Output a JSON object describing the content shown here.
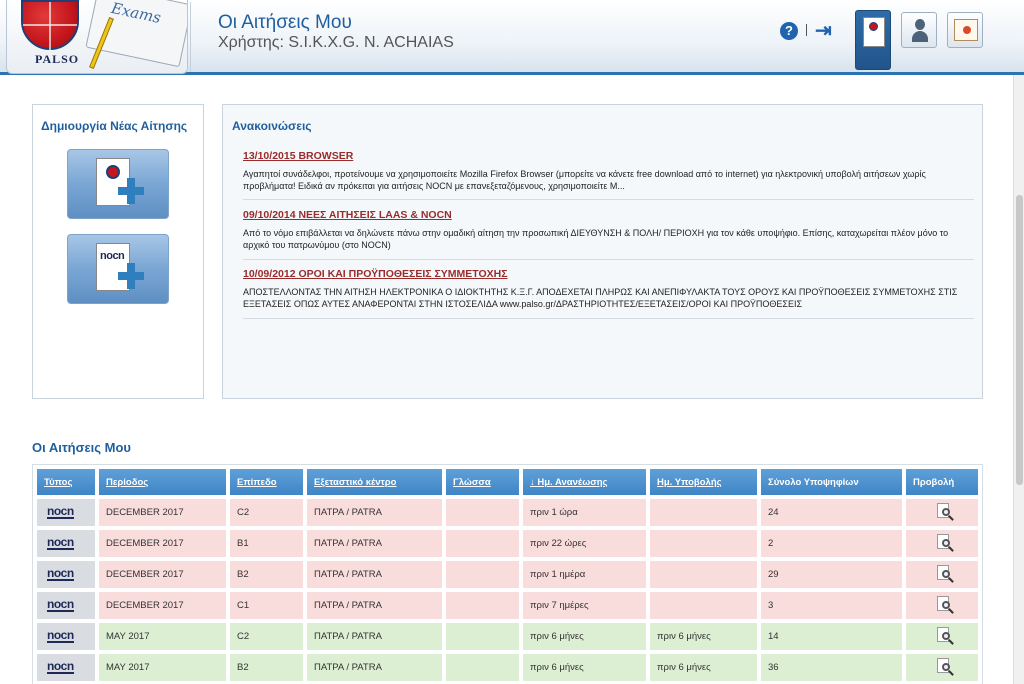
{
  "header": {
    "logo_text": "PALSO",
    "exams_text": "Exams",
    "page_title": "Οι Αιτήσεις Μου",
    "user_line": "Χρήστης: S.I.K.X.G. N. ACHAIAS",
    "help_symbol": "?",
    "logout_symbol": "⇥"
  },
  "create_panel": {
    "heading": "Δημιουργία Νέας Αίτησης",
    "nocn_label": "nocn"
  },
  "announcements": {
    "heading": "Ανακοινώσεις",
    "items": [
      {
        "title": "13/10/2015 BROWSER",
        "body": "Αγαπητοί συνάδελφοι, προτείνουμε να χρησιμοποιείτε Mozilla Firefox Browser (μπορείτε να κάνετε free download από το internet) για ηλεκτρονική υποβολή αιτήσεων χωρίς προβλήματα! Ειδικά αν πρόκειται για αιτήσεις NOCN με επανεξεταζόμενους, χρησιμοποιείτε M..."
      },
      {
        "title": "09/10/2014 ΝΕΕΣ ΑΙΤΗΣΕΙΣ LAAS & NOCN",
        "body": "Από το νόμο επιβάλλεται να δηλώνετε πάνω στην ομαδική αίτηση την προσωπική ΔΙΕΥΘΥΝΣΗ & ΠΟΛΗ/ ΠΕΡΙΟΧΗ για τον κάθε υποψήφιο. Επίσης, καταχωρείται πλέον μόνο το αρχικό του πατρωνύμου (στο NOCN)"
      },
      {
        "title": "10/09/2012 ΟΡΟΙ ΚΑΙ ΠΡΟΫΠΟΘΕΣΕΙΣ ΣΥΜΜΕΤΟΧΗΣ",
        "body": "ΑΠΟΣΤΕΛΛΟΝΤΑΣ ΤΗΝ ΑΙΤΗΣΗ ΗΛΕΚΤΡΟΝΙΚΑ Ο ΙΔΙΟΚΤΗΤΗΣ Κ.Ξ.Γ. ΑΠΟΔΕΧΕΤΑΙ ΠΛΗΡΩΣ ΚΑΙ ΑΝΕΠΙΦΥΛΑΚΤΑ ΤΟΥΣ ΟΡΟΥΣ ΚΑΙ ΠΡΟΫΠΟΘΕΣΕΙΣ ΣΥΜΜΕΤΟΧΗΣ ΣΤΙΣ ΕΞΕΤΑΣΕΙΣ ΟΠΩΣ ΑΥΤΕΣ ΑΝΑΦΕΡΟΝΤΑΙ ΣΤΗΝ ΙΣΤΟΣΕΛΙΔΑ www.palso.gr/ΔΡΑΣΤΗΡΙΟΤΗΤΕΣ/ΕΞΕΤΑΣΕΙΣ/ΟΡΟΙ ΚΑΙ ΠΡΟΫΠΟΘΕΣΕΙΣ"
      }
    ]
  },
  "applications": {
    "heading": "Οι Αιτήσεις Μου",
    "columns": [
      "Τύπος",
      "Περίοδος",
      "Επίπεδο",
      "Εξεταστικό κέντρο",
      "Γλώσσα",
      "↓ Ημ. Ανανέωσης",
      "Ημ. Υποβολής",
      "Σύνολο Υποψηφίων",
      "Προβολή"
    ],
    "type_label": "nocn",
    "rows": [
      {
        "status": "pink",
        "period": "DECEMBER 2017",
        "level": "C2",
        "center": "ΠΑΤΡΑ / PATRA",
        "language": "",
        "updated": "πριν 1 ώρα",
        "submitted": "",
        "total": "24"
      },
      {
        "status": "pink",
        "period": "DECEMBER 2017",
        "level": "B1",
        "center": "ΠΑΤΡΑ / PATRA",
        "language": "",
        "updated": "πριν 22 ώρες",
        "submitted": "",
        "total": "2"
      },
      {
        "status": "pink",
        "period": "DECEMBER 2017",
        "level": "B2",
        "center": "ΠΑΤΡΑ / PATRA",
        "language": "",
        "updated": "πριν 1 ημέρα",
        "submitted": "",
        "total": "29"
      },
      {
        "status": "pink",
        "period": "DECEMBER 2017",
        "level": "C1",
        "center": "ΠΑΤΡΑ / PATRA",
        "language": "",
        "updated": "πριν 7 ημέρες",
        "submitted": "",
        "total": "3"
      },
      {
        "status": "green",
        "period": "MAY 2017",
        "level": "C2",
        "center": "ΠΑΤΡΑ / PATRA",
        "language": "",
        "updated": "πριν 6 μήνες",
        "submitted": "πριν 6 μήνες",
        "total": "14"
      },
      {
        "status": "green",
        "period": "MAY 2017",
        "level": "B2",
        "center": "ΠΑΤΡΑ / PATRA",
        "language": "",
        "updated": "πριν 6 μήνες",
        "submitted": "πριν 6 μήνες",
        "total": "36"
      }
    ]
  },
  "colors": {
    "accent": "#1f5f9e",
    "header_col": "#3f86c6",
    "draft_row": "#f9dcdc",
    "submitted_row": "#dcefd3"
  }
}
